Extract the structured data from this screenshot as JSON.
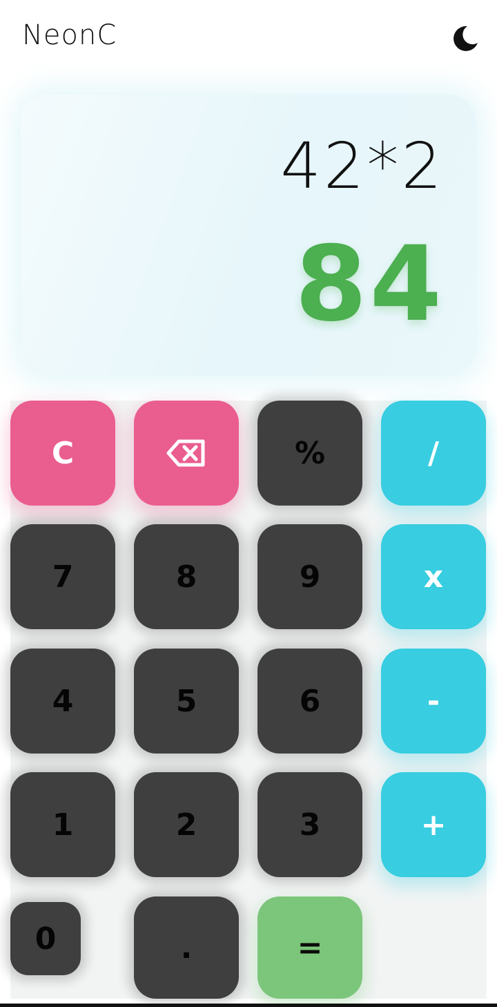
{
  "app": {
    "title": "NeonC",
    "theme_icon": "moon-icon"
  },
  "display": {
    "expression": "42*2",
    "result": "84",
    "result_color": "#4caf50"
  },
  "colors": {
    "clear": "#ea5d8f",
    "operator": "#38cde0",
    "digit": "#3f3f3f",
    "equals": "#7cc67b"
  },
  "keys": {
    "clear": "C",
    "backspace_icon": "backspace-icon",
    "percent": "%",
    "divide": "/",
    "seven": "7",
    "eight": "8",
    "nine": "9",
    "multiply": "x",
    "four": "4",
    "five": "5",
    "six": "6",
    "minus": "-",
    "one": "1",
    "two": "2",
    "three": "3",
    "plus": "+",
    "zero": "0",
    "dot": ".",
    "equals": "="
  }
}
